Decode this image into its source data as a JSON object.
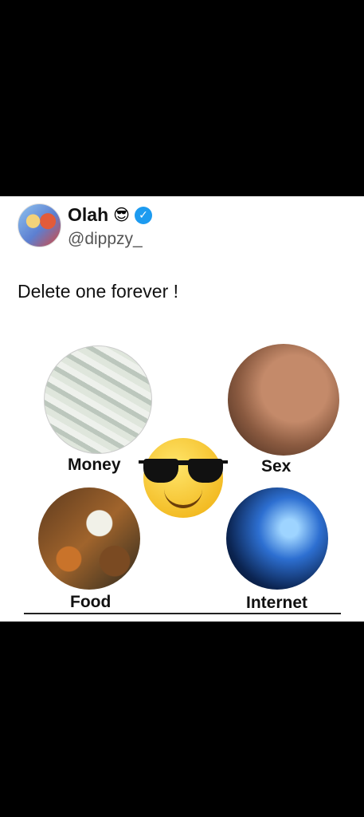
{
  "post": {
    "display_name": "Olah",
    "name_emoji": "😎",
    "handle": "@dippzy_",
    "text": "Delete one forever !",
    "verified_icon": "verified-badge-icon",
    "accent_color": "#1d9bf0"
  },
  "media": {
    "labels": {
      "money": "Money",
      "sex": "Sex",
      "food": "Food",
      "internet": "Internet"
    },
    "center_emoji": "sunglasses-smiley"
  }
}
